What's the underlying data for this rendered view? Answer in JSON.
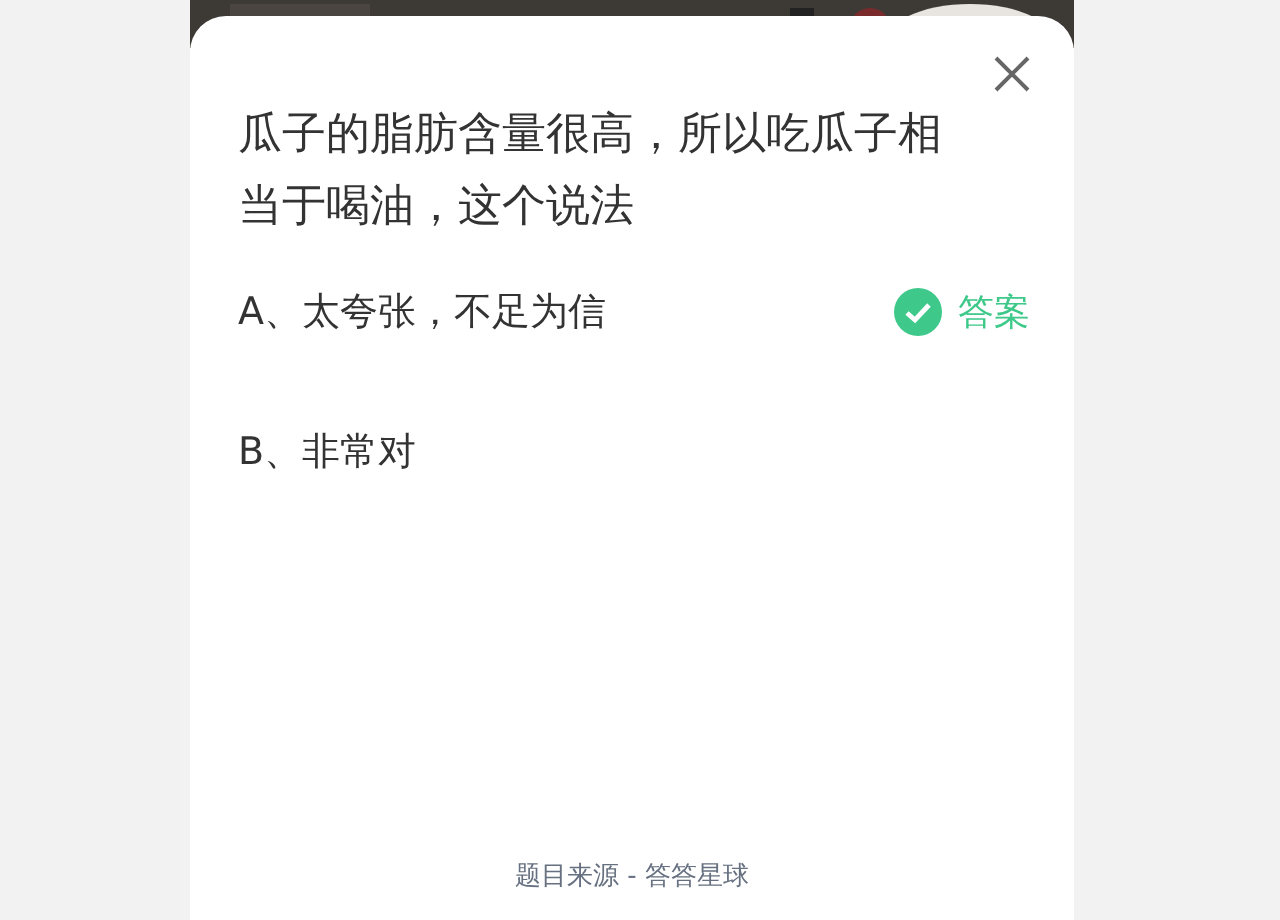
{
  "question": "瓜子的脂肪含量很高，所以吃瓜子相当于喝油，这个说法",
  "options": [
    {
      "label": "A、太夸张，不足为信",
      "correct": true,
      "answer_label": "答案"
    },
    {
      "label": "B、非常对",
      "correct": false
    }
  ],
  "source": "题目来源 - 答答星球"
}
